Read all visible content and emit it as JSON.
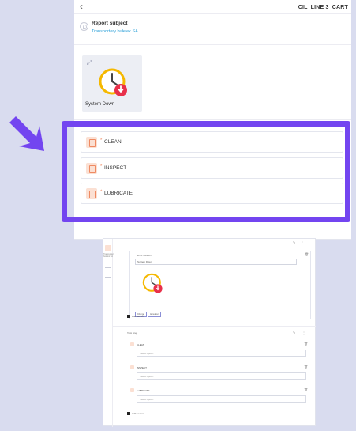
{
  "header": {
    "title": "CIL_LINE 3_CART",
    "back_icon": "chevron-left-icon"
  },
  "report_subject": {
    "label": "Report subject",
    "value": "Transportery bułelek SA"
  },
  "problem_card": {
    "label": "System Down",
    "icon": "clock-alert-icon"
  },
  "tasks": [
    {
      "star": "*",
      "label": "CLEAN"
    },
    {
      "star": "*",
      "label": "INSPECT"
    },
    {
      "star": "*",
      "label": "LUBRICATE"
    }
  ],
  "highlight_color": "#7345f0",
  "mini": {
    "sidebar_text": "Transporter bułelek SA",
    "problem_section": "Error Reason",
    "problem_value": "System Down",
    "btn_change": "Change",
    "btn_remove": "Annuleren",
    "add_section": "Add section",
    "task_section": "Task Step",
    "tasks": [
      {
        "label": "CLEAN",
        "placeholder": "Select option"
      },
      {
        "label": "INSPECT",
        "placeholder": "Select option"
      },
      {
        "label": "LUBRICATE",
        "placeholder": "Select option"
      }
    ],
    "add_section_2": "Add section"
  }
}
